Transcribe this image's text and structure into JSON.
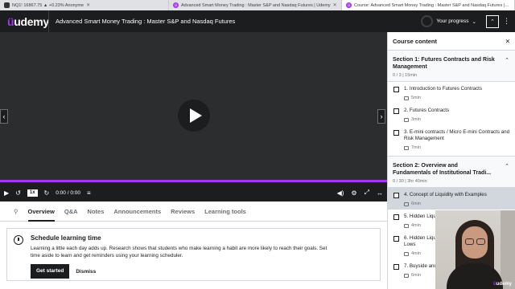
{
  "browser": {
    "tabs": [
      {
        "title": "NQ1! 16867.75 ▲ +0.23% Anonyme",
        "active": false
      },
      {
        "title": "Advanced Smart Money Trading : Master S&P and Nasdaq Futures | Udemy",
        "active": false
      },
      {
        "title": "Course: Advanced Smart Money Trading : Master S&P and Nasdaq Futures | U...",
        "active": true
      }
    ]
  },
  "header": {
    "logo": "udemy",
    "course_title": "Advanced Smart Money Trading : Master S&P and Nasdaq Futures",
    "progress_label": "Your progress"
  },
  "player": {
    "speed": "1x",
    "time": "0:00 / 0:00",
    "progress_fraction": 1.0
  },
  "tabs": {
    "items": [
      "Overview",
      "Q&A",
      "Notes",
      "Announcements",
      "Reviews",
      "Learning tools"
    ],
    "active": "Overview"
  },
  "schedule": {
    "title": "Schedule learning time",
    "body": "Learning a little each day adds up. Research shows that students who make learning a habit are more likely to reach their goals. Set time aside to learn and get reminders using your learning scheduler.",
    "primary_button": "Get started",
    "secondary_button": "Dismiss"
  },
  "sidebar": {
    "title": "Course content",
    "sections": [
      {
        "title": "Section 1: Futures Contracts and Risk Management",
        "meta": "0 / 3 | 15min",
        "items": [
          {
            "title": "1. Introduction to Futures Contracts",
            "duration": "5min"
          },
          {
            "title": "2. Futures Contracts",
            "duration": "3min"
          },
          {
            "title": "3. E-mini contracts / Micro E-mini Contracts and Risk Management",
            "duration": "7min"
          }
        ]
      },
      {
        "title": "Section 2: Overview and Fundamentals of Institutional Tradi...",
        "meta": "0 / 30 | 3hr 40min",
        "items": [
          {
            "title": "4. Concept of Liquidity with Examples",
            "duration": "6min",
            "current": true
          },
          {
            "title": "5. Hidden Liqu",
            "duration": "4min"
          },
          {
            "title": "6. Hidden Liqu Lows",
            "duration": "4min"
          },
          {
            "title": "7. Buyside and",
            "duration": "6min"
          }
        ]
      }
    ]
  },
  "webcam": {
    "watermark": "udemy"
  }
}
